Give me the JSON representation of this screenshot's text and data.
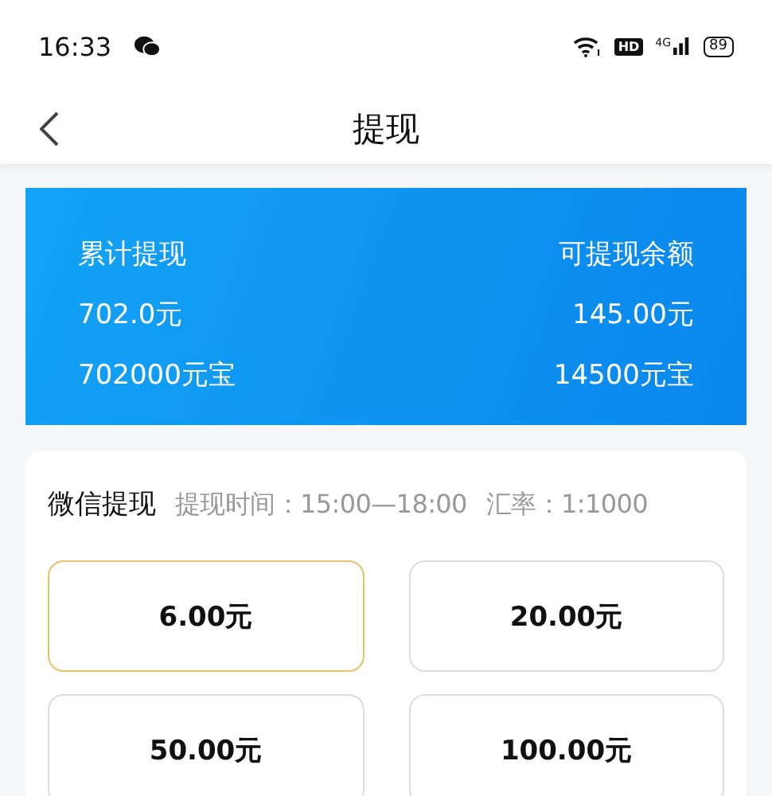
{
  "status_bar": {
    "time": "16:33",
    "hd": "HD",
    "network": "4G",
    "battery": "89"
  },
  "nav_bar": {
    "title": "提现"
  },
  "summary": {
    "left": [
      "累计提现",
      "702.0元",
      "702000元宝"
    ],
    "right": [
      "可提现余额",
      "145.00元",
      "14500元宝"
    ]
  },
  "withdraw": {
    "title": "微信提现",
    "time": "提现时间：15:00—18:00",
    "rate": "汇率：1:1000",
    "options": [
      {
        "label": "6.00元",
        "selected": true
      },
      {
        "label": "20.00元",
        "selected": false
      },
      {
        "label": "50.00元",
        "selected": false
      },
      {
        "label": "100.00元",
        "selected": false
      }
    ]
  }
}
